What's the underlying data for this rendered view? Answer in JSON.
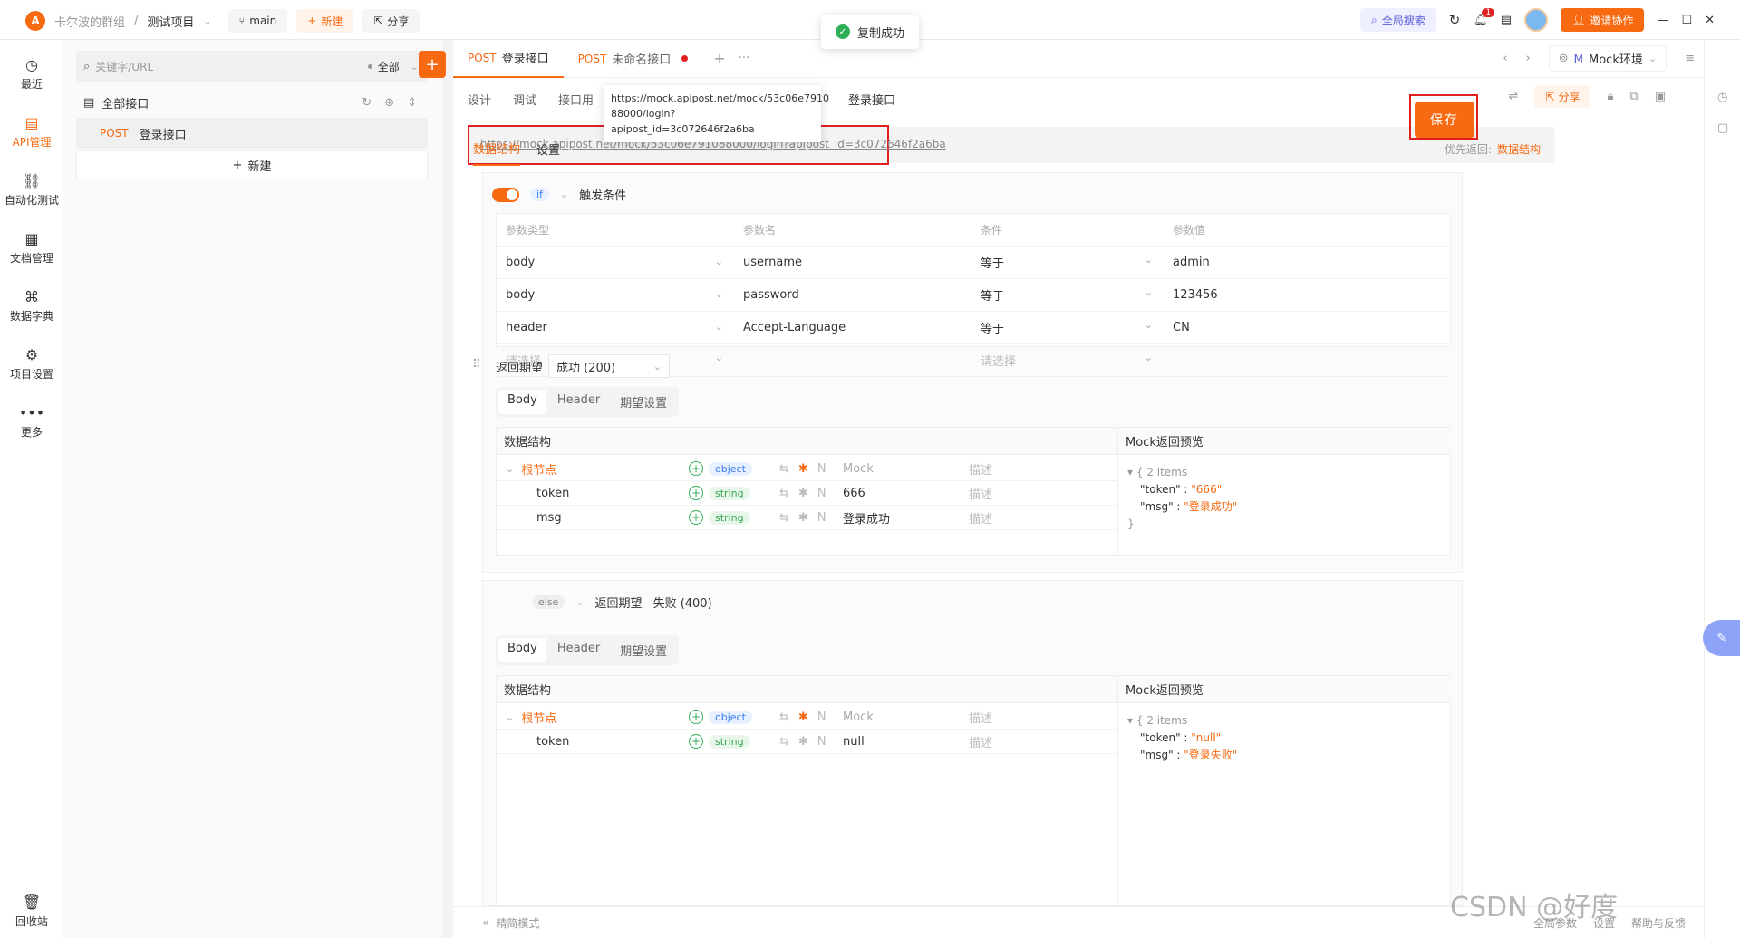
{
  "topbar": {
    "team": "卡尔波的群组",
    "project": "测试项目",
    "branch": "main",
    "new_label": "新建",
    "share_label": "分享",
    "toast": "复制成功",
    "global_search": "全局搜索",
    "notify_count": "1",
    "invite_label": "邀请协作"
  },
  "nav": [
    {
      "label": "最近",
      "icon": "clock-icon",
      "glyph": "◷"
    },
    {
      "label": "API管理",
      "icon": "api-icon",
      "glyph": "▤"
    },
    {
      "label": "自动化测试",
      "icon": "flow-icon",
      "glyph": "⛓"
    },
    {
      "label": "文档管理",
      "icon": "doc-icon",
      "glyph": "▦"
    },
    {
      "label": "数据字典",
      "icon": "dictionary-icon",
      "glyph": "⌘"
    },
    {
      "label": "项目设置",
      "icon": "settings-icon",
      "glyph": "⚙"
    },
    {
      "label": "更多",
      "icon": "more-icon",
      "glyph": "•••"
    }
  ],
  "recycle_label": "回收站",
  "sidebar": {
    "search_placeholder": "关键字/URL",
    "filter": "全部",
    "all_apis": "全部接口",
    "api_method": "POST",
    "api_name": "登录接口",
    "new_label": "新建"
  },
  "tabs": [
    {
      "method": "POST",
      "name": "登录接口"
    },
    {
      "method": "POST",
      "name": "未命名接口"
    }
  ],
  "env": {
    "prefix": "M",
    "name": "Mock环境"
  },
  "subnav": [
    "设计",
    "调试",
    "接口用"
  ],
  "tooltip": {
    "line1": "https://mock.apipost.net/mock/53c06e7910",
    "line2": "88000/login?apipost_id=3c072646f2a6ba"
  },
  "api_title": "登录接口",
  "share_label": "分享",
  "url": "https://mock.apipost.net/mock/53c06e791088000/login?apipost_id=3c072646f2a6ba",
  "save_label": "保存",
  "section_tabs": [
    "数据结构",
    "设置"
  ],
  "priority_label": "优先返回:",
  "priority_value": "数据结构",
  "if_block": {
    "if_tag": "if",
    "trigger_label": "触发条件",
    "headers": [
      "参数类型",
      "参数名",
      "条件",
      "参数值"
    ],
    "rows": [
      {
        "type": "body",
        "name": "username",
        "cond": "等于",
        "value": "admin"
      },
      {
        "type": "body",
        "name": "password",
        "cond": "等于",
        "value": "123456"
      },
      {
        "type": "header",
        "name": "Accept-Language",
        "cond": "等于",
        "value": "CN"
      }
    ],
    "placeholder_type": "请选择",
    "placeholder_cond": "请选择",
    "expect_label": "返回期望",
    "expect_value": "成功 (200)",
    "subtabs": [
      "Body",
      "Header",
      "期望设置"
    ],
    "struct_title": "数据结构",
    "preview_title": "Mock返回预览",
    "fields": [
      {
        "name": "根节点",
        "type": "object",
        "mock": "Mock",
        "desc": "描述"
      },
      {
        "name": "token",
        "type": "string",
        "mock": "666",
        "desc": "描述"
      },
      {
        "name": "msg",
        "type": "string",
        "mock": "登录成功",
        "desc": "描述"
      }
    ],
    "preview": {
      "count": "2 items",
      "k1": "\"token\"",
      "v1": "\"666\"",
      "k2": "\"msg\"",
      "v2": "\"登录成功\""
    }
  },
  "else_block": {
    "else_tag": "else",
    "expect_label": "返回期望",
    "expect_value": "失败 (400)",
    "subtabs": [
      "Body",
      "Header",
      "期望设置"
    ],
    "struct_title": "数据结构",
    "preview_title": "Mock返回预览",
    "fields": [
      {
        "name": "根节点",
        "type": "object",
        "mock": "Mock",
        "desc": "描述"
      },
      {
        "name": "token",
        "type": "string",
        "mock": "null",
        "desc": "描述"
      }
    ],
    "preview": {
      "count": "2 items",
      "k1": "\"token\"",
      "v1": "\"null\"",
      "k2": "\"msg\"",
      "v2": "\"登录失败\""
    }
  },
  "footer": {
    "left": "精简模式",
    "global_params": "全局参数",
    "settings": "设置",
    "shortcuts": "帮助与反馈"
  },
  "watermark": "CSDN @好度",
  "colors": {
    "accent": "#f76a12",
    "highlight": "#e02020",
    "success": "#2eae56"
  }
}
